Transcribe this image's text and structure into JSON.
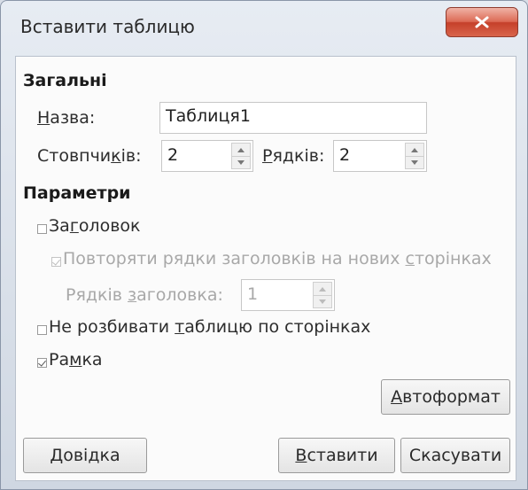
{
  "window": {
    "title": "Вставити таблицю",
    "close_icon": "close-icon",
    "close_color": "#c5402a"
  },
  "general": {
    "heading": "Загальні",
    "name_label_u": "Н",
    "name_label_rest": "азва:",
    "name_value": "Таблиця1",
    "columns_label_pre": "Стовпчи",
    "columns_label_u": "к",
    "columns_label_post": "ів:",
    "columns_value": "2",
    "rows_label_u": "Р",
    "rows_label_rest": "ядків:",
    "rows_value": "2"
  },
  "options": {
    "heading": "Параметри",
    "heading_checkbox": {
      "pre": "За",
      "u": "г",
      "post": "оловок",
      "checked": false
    },
    "repeat_rows": {
      "pre": "Повторяти рядки заголовків на нових ",
      "u": "с",
      "post": "торінках",
      "checked": true,
      "disabled": true
    },
    "heading_rows": {
      "pre": "Рядків ",
      "u": "з",
      "post": "аголовка:",
      "value": "1",
      "disabled": true
    },
    "dont_split": {
      "pre": "Не розбивати ",
      "u": "т",
      "post": "аблицю по сторінках",
      "checked": false
    },
    "border": {
      "pre": "Ра",
      "u": "м",
      "post": "ка",
      "checked": true
    }
  },
  "buttons": {
    "autoformat_u": "А",
    "autoformat_rest": "втоформат",
    "help_u": "Д",
    "help_rest": "овідка",
    "insert_u": "В",
    "insert_rest": "ставити",
    "cancel": "Скасувати"
  }
}
